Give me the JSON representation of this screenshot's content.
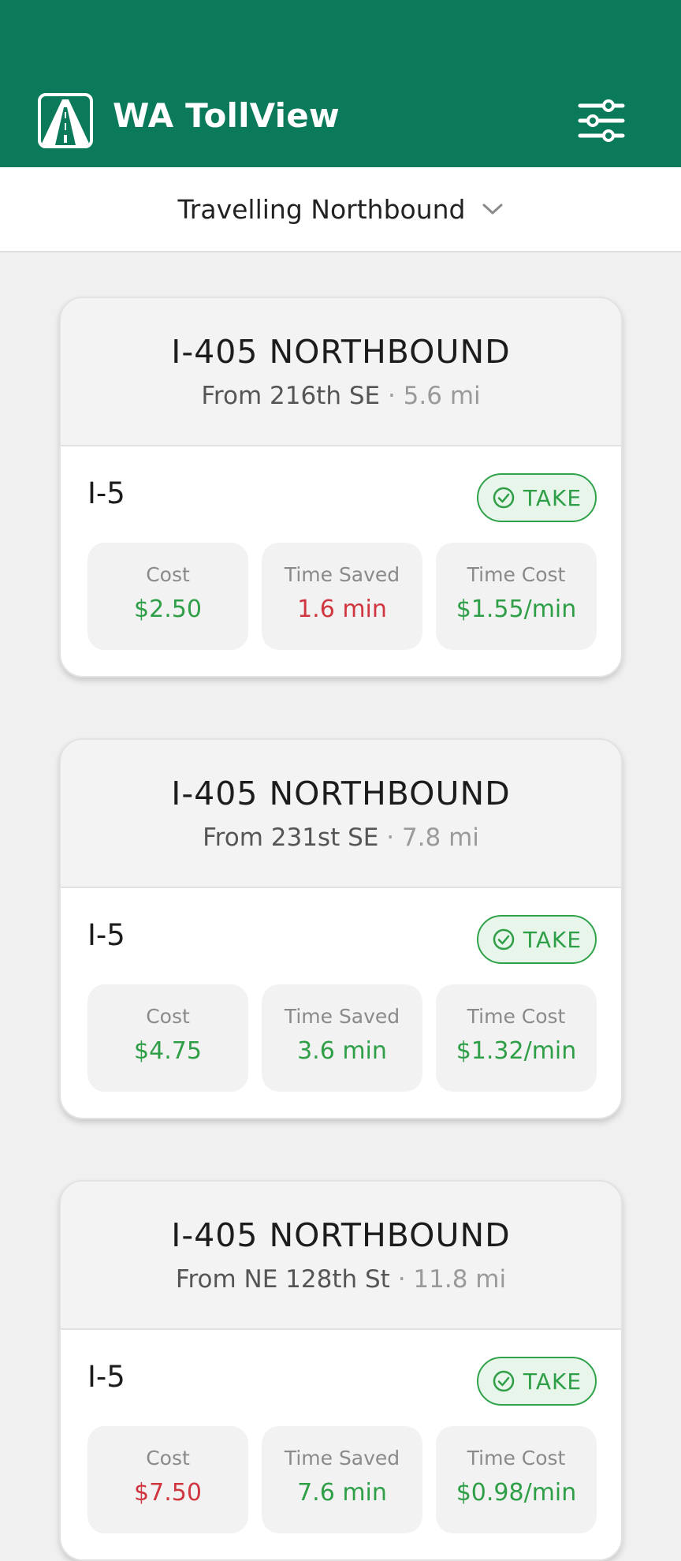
{
  "app": {
    "title": "WA TollView",
    "logo_icon": "road-logo-icon",
    "filter_icon": "sliders-icon"
  },
  "direction": {
    "label": "Travelling Northbound",
    "chevron_icon": "chevron-down-icon"
  },
  "colors": {
    "header": "#0a7a5a",
    "green": "#2e9e47",
    "red": "#d0363f"
  },
  "cards": [
    {
      "title": "I-405 NORTHBOUND",
      "from": "From 216th SE",
      "separator": "·",
      "distance": "5.6 mi",
      "route": "I-5",
      "action": "TAKE",
      "stats": [
        {
          "label": "Cost",
          "value": "$2.50",
          "tone": "green"
        },
        {
          "label": "Time Saved",
          "value": "1.6 min",
          "tone": "red"
        },
        {
          "label": "Time Cost",
          "value": "$1.55/min",
          "tone": "green"
        }
      ]
    },
    {
      "title": "I-405 NORTHBOUND",
      "from": "From 231st SE",
      "separator": "·",
      "distance": "7.8 mi",
      "route": "I-5",
      "action": "TAKE",
      "stats": [
        {
          "label": "Cost",
          "value": "$4.75",
          "tone": "green"
        },
        {
          "label": "Time Saved",
          "value": "3.6 min",
          "tone": "green"
        },
        {
          "label": "Time Cost",
          "value": "$1.32/min",
          "tone": "green"
        }
      ]
    },
    {
      "title": "I-405 NORTHBOUND",
      "from": "From NE 128th St",
      "separator": "·",
      "distance": "11.8 mi",
      "route": "I-5",
      "action": "TAKE",
      "stats": [
        {
          "label": "Cost",
          "value": "$7.50",
          "tone": "red"
        },
        {
          "label": "Time Saved",
          "value": "7.6 min",
          "tone": "green"
        },
        {
          "label": "Time Cost",
          "value": "$0.98/min",
          "tone": "green"
        }
      ]
    }
  ]
}
